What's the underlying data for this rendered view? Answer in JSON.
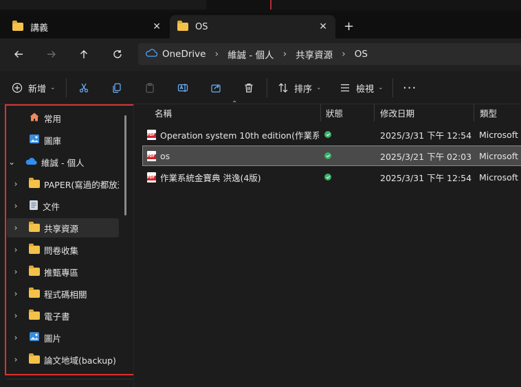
{
  "tabs": [
    {
      "label": "講義",
      "active": false
    },
    {
      "label": "OS",
      "active": true
    }
  ],
  "new_tab_icon": "plus-icon",
  "breadcrumb": [
    "OneDrive",
    "維誠 - 個人",
    "共享資源",
    "OS"
  ],
  "toolbar": {
    "new_label": "新增",
    "sort_label": "排序",
    "view_label": "檢視"
  },
  "sidebar": {
    "items": [
      {
        "label": "常用",
        "icon": "home-icon",
        "expand": "none"
      },
      {
        "label": "圖庫",
        "icon": "gallery-icon",
        "expand": "none"
      },
      {
        "label": "維誠 - 個人",
        "icon": "onedrive-cloud-icon",
        "expand": "expanded"
      },
      {
        "label": "PAPER(寫過的都放這",
        "icon": "folder-icon",
        "expand": "collapsed"
      },
      {
        "label": "文件",
        "icon": "document-icon",
        "expand": "collapsed"
      },
      {
        "label": "共享資源",
        "icon": "folder-icon",
        "expand": "collapsed",
        "selected": true
      },
      {
        "label": "問卷收集",
        "icon": "folder-icon",
        "expand": "collapsed"
      },
      {
        "label": "推甄專區",
        "icon": "folder-icon",
        "expand": "collapsed"
      },
      {
        "label": "程式碼相關",
        "icon": "folder-icon",
        "expand": "collapsed"
      },
      {
        "label": "電子書",
        "icon": "folder-icon",
        "expand": "collapsed"
      },
      {
        "label": "圖片",
        "icon": "pictures-icon",
        "expand": "collapsed"
      },
      {
        "label": "論文地域(backup)",
        "icon": "folder-icon",
        "expand": "collapsed"
      }
    ]
  },
  "columns": [
    "名稱",
    "狀態",
    "修改日期",
    "類型"
  ],
  "files": [
    {
      "name": "Operation system 10th edition(作業系...",
      "date": "2025/3/31 下午 12:54",
      "type": "Microsoft E"
    },
    {
      "name": "os",
      "date": "2025/3/21 下午 02:03",
      "type": "Microsoft E",
      "selected": true
    },
    {
      "name": "作業系統金寶典 洪逸(4版)",
      "date": "2025/3/31 下午 12:54",
      "type": "Microsoft E"
    }
  ],
  "colors": {
    "accent_red": "#e03030",
    "status_green": "#38b26b",
    "folder_yellow": "#f4c24a",
    "onedrive_blue": "#2f8ef0"
  }
}
